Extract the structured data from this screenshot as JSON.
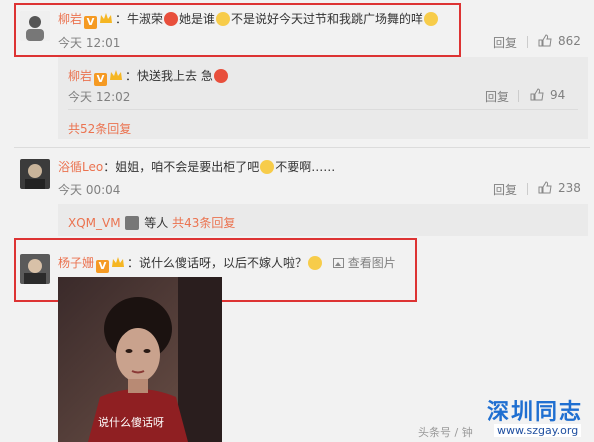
{
  "comments": [
    {
      "user": "柳岩",
      "text_a": "：牛淑荣",
      "text_b": "她是谁",
      "text_c": "不是说好今天过节和我跳广场舞的咩",
      "time": "今天 12:01",
      "reply_label": "回复",
      "likes": "862"
    },
    {
      "user": "柳岩",
      "text_a": "：快送我上去 急",
      "time": "今天 12:02",
      "reply_label": "回复",
      "likes": "94"
    },
    {
      "user": "浴循Leo",
      "text_a": "：姐姐，咱不会是要出柜了吧",
      "text_b": "不要啊……",
      "time": "今天 00:04",
      "reply_label": "回复",
      "likes": "238"
    },
    {
      "user": "杨子姗",
      "text_a": "：说什么傻话呀，以后不嫁人啦？",
      "view_image": "查看图片"
    }
  ],
  "more_replies_1": "共52条回复",
  "thread_2": {
    "user": "XQM_VM",
    "suffix": "等人",
    "more": "共43条回复"
  },
  "image_caption": "说什么傻话呀",
  "watermark": {
    "brand": "深圳同志",
    "url": "www.szgay.org",
    "source": "头条号 / 钟"
  },
  "colors": {
    "accent": "#eb7350",
    "highlight": "#d33333",
    "vip": "#f59a23"
  }
}
